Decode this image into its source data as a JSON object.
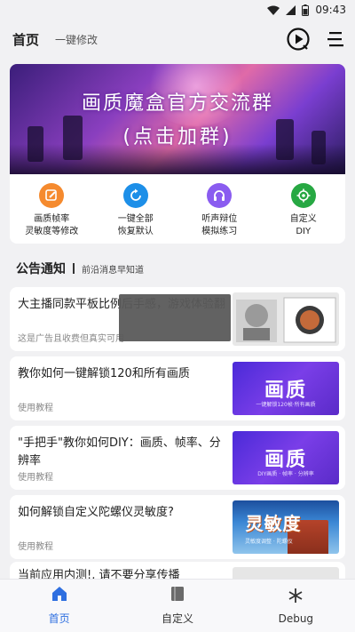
{
  "status": {
    "time": "09:43"
  },
  "header": {
    "title": "首页",
    "subtitle": "一键修改"
  },
  "banner": {
    "line1": "画质魔盒官方交流群",
    "line2": "(点击加群)"
  },
  "tools": [
    {
      "label1": "画质帧率",
      "label2": "灵敏度等修改",
      "color": "#f58a2e"
    },
    {
      "label1": "一键全部",
      "label2": "恢复默认",
      "color": "#1d8fe8"
    },
    {
      "label1": "听声辩位",
      "label2": "模拟练习",
      "color": "#8a5cf0"
    },
    {
      "label1": "自定义",
      "label2": "DIY",
      "color": "#27a843"
    }
  ],
  "notice": {
    "title": "公告通知",
    "subtitle": "前沿消息早知道"
  },
  "articles": [
    {
      "title": "大主播同款平板比例后手感，游戏体验翻",
      "tag": "这是广告且收费但真实可用"
    },
    {
      "title": "教你如何一键解锁120和所有画质",
      "tag": "使用教程",
      "thumb": "画质",
      "thumb_small": "一键解锁120帧·所有画质"
    },
    {
      "title": "\"手把手\"教你如何DIY：画质、帧率、分辨率",
      "tag": "使用教程",
      "thumb": "画质",
      "thumb_small": "DIY画质 · 帧率 · 分辨率"
    },
    {
      "title": "如何解锁自定义陀螺仪灵敏度?",
      "tag": "使用教程",
      "thumb": "灵敏度",
      "thumb_small": "灵敏度调整 · 陀螺仪"
    },
    {
      "title": "当前应用内测!, 请不要分享传播"
    }
  ],
  "nav": [
    {
      "label": "首页"
    },
    {
      "label": "自定义"
    },
    {
      "label": "Debug"
    }
  ],
  "colors": {
    "accent": "#2e6fe0"
  }
}
